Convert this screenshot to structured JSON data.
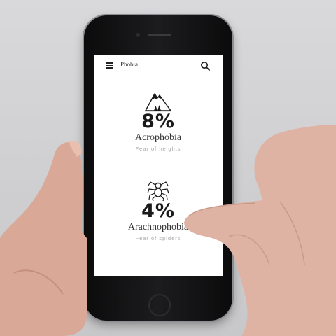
{
  "app": {
    "title": "Phobia"
  },
  "icons": {
    "menu": "hamburger-menu-icon",
    "search": "search-icon"
  },
  "phobias": [
    {
      "percent": "8%",
      "name": "Acrophobia",
      "description": "Fear of heights",
      "icon": "mountain-icon"
    },
    {
      "percent": "4%",
      "name": "Arachnophobia",
      "description": "Fear of spiders",
      "icon": "spider-icon"
    }
  ]
}
